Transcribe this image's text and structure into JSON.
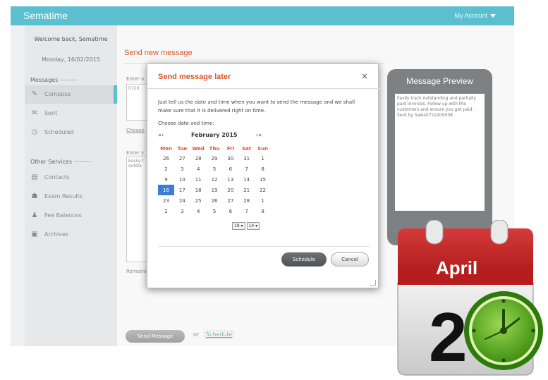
{
  "app": {
    "brand": "Sematime",
    "account": "My Account"
  },
  "sidebar": {
    "welcome": "Welcome back, Sematime",
    "date": "Monday, 16/02/2015",
    "messages_heading": "Messages",
    "messages": [
      {
        "label": "Compose",
        "icon": "compose-icon"
      },
      {
        "label": "Sent",
        "icon": "sent-icon"
      },
      {
        "label": "Scheduled",
        "icon": "scheduled-icon"
      }
    ],
    "other_heading": "Other Services",
    "other": [
      {
        "label": "Contacts",
        "icon": "contacts-icon"
      },
      {
        "label": "Exam Results",
        "icon": "exam-results-icon"
      },
      {
        "label": "Fee Balances",
        "icon": "fee-balances-icon"
      },
      {
        "label": "Archives",
        "icon": "archives-icon"
      }
    ]
  },
  "main": {
    "title": "Send new message",
    "recipients_label": "Enter n",
    "recipients_value": "0720",
    "choose_link": "Choose",
    "message_label": "Enter y",
    "message_value": "Easily t\noutsta",
    "remaining_label": "Remaini",
    "send_button": "Send Message",
    "or_text": "or",
    "schedule_link": "Schedule"
  },
  "preview": {
    "title": "Message Preview",
    "body": "Easily track outstanding and partially paid invoices. Follow up with the customers and ensure you get paid. Sent by Sales0722209508"
  },
  "modal": {
    "title": "Send message later",
    "close": "×",
    "description": "Just tell us the date and time when you want to send the message and we shall make sure that it is delivered right on time.",
    "choose_label": "Choose date and time:",
    "prev_nav": "«‹",
    "next_nav": "›»",
    "month": "February 2015",
    "weekdays": [
      "Mon",
      "Tue",
      "Wed",
      "Thu",
      "Fri",
      "Sat",
      "Sun"
    ],
    "weeks": [
      [
        "26",
        "27",
        "28",
        "29",
        "30",
        "31",
        "1"
      ],
      [
        "2",
        "3",
        "4",
        "5",
        "6",
        "7",
        "8"
      ],
      [
        "9",
        "10",
        "11",
        "12",
        "13",
        "14",
        "15"
      ],
      [
        "16",
        "17",
        "18",
        "19",
        "20",
        "21",
        "22"
      ],
      [
        "23",
        "24",
        "25",
        "26",
        "27",
        "28",
        "1"
      ],
      [
        "2",
        "3",
        "4",
        "5",
        "6",
        "7",
        "8"
      ]
    ],
    "selected_day": "16",
    "hour": "19",
    "minute": "14",
    "schedule_button": "Schedule",
    "cancel_button": "Cancel"
  },
  "clipart": {
    "month": "April",
    "day": "2"
  },
  "colors": {
    "brand": "#5bbfcf",
    "accent": "#e0532a",
    "selected_day": "#3d7dd6",
    "calendar_red": "#c21b1b",
    "clock_green": "#4ea51e"
  }
}
